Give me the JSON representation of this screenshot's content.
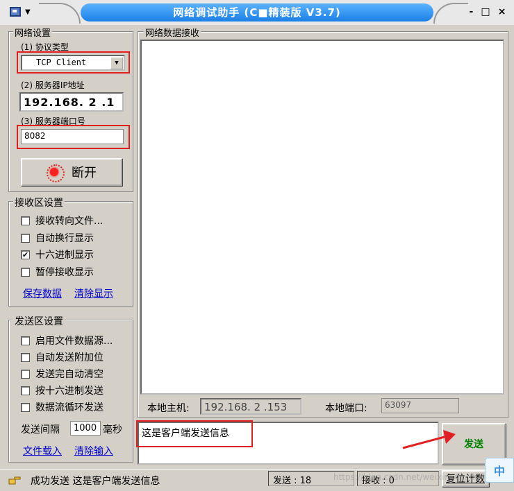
{
  "window": {
    "title": "网络调试助手 (C■精装版 V3.7)",
    "controls": [
      "-",
      "□",
      "×"
    ]
  },
  "network_settings": {
    "title": "网络设置",
    "protocol_label": "(1) 协议类型",
    "protocol_value": "TCP Client",
    "ip_label": "(2) 服务器IP地址",
    "ip_value": "192.168. 2 .1",
    "port_label": "(3) 服务器端口号",
    "port_value": "8082",
    "connect_button": "断开"
  },
  "receive_settings": {
    "title": "接收区设置",
    "options": [
      {
        "label": "接收转向文件...",
        "checked": false
      },
      {
        "label": "自动换行显示",
        "checked": false
      },
      {
        "label": "十六进制显示",
        "checked": true
      },
      {
        "label": "暂停接收显示",
        "checked": false
      }
    ],
    "save_link": "保存数据",
    "clear_link": "清除显示"
  },
  "send_settings": {
    "title": "发送区设置",
    "options": [
      {
        "label": "启用文件数据源...",
        "checked": false
      },
      {
        "label": "自动发送附加位",
        "checked": false
      },
      {
        "label": "发送完自动清空",
        "checked": false
      },
      {
        "label": "按十六进制发送",
        "checked": false
      },
      {
        "label": "数据流循环发送",
        "checked": false
      }
    ],
    "interval_label": "发送间隔",
    "interval_value": "1000",
    "interval_unit": "毫秒",
    "load_link": "文件载入",
    "clear_link": "清除输入"
  },
  "receive_area": {
    "title": "网络数据接收"
  },
  "local": {
    "host_label": "本地主机:",
    "host_value": "192.168. 2 .153",
    "port_label": "本地端口:",
    "port_value": "63097"
  },
  "send_area": {
    "text": "这是客户端发送信息",
    "send_button": "发送"
  },
  "status": {
    "message": "成功发送 这是客户端发送信息",
    "sent_label": "发送 : 18",
    "recv_label": "接收 : 0",
    "reset_button": "复位计数",
    "corner_badge": "中",
    "watermark": "https://blog.csdn.net/weixin_4... 0045"
  },
  "colors": {
    "highlight_red": "#e02020",
    "title_blue": "#1a80e6",
    "link_blue": "#0000cc",
    "send_green": "#008000"
  }
}
